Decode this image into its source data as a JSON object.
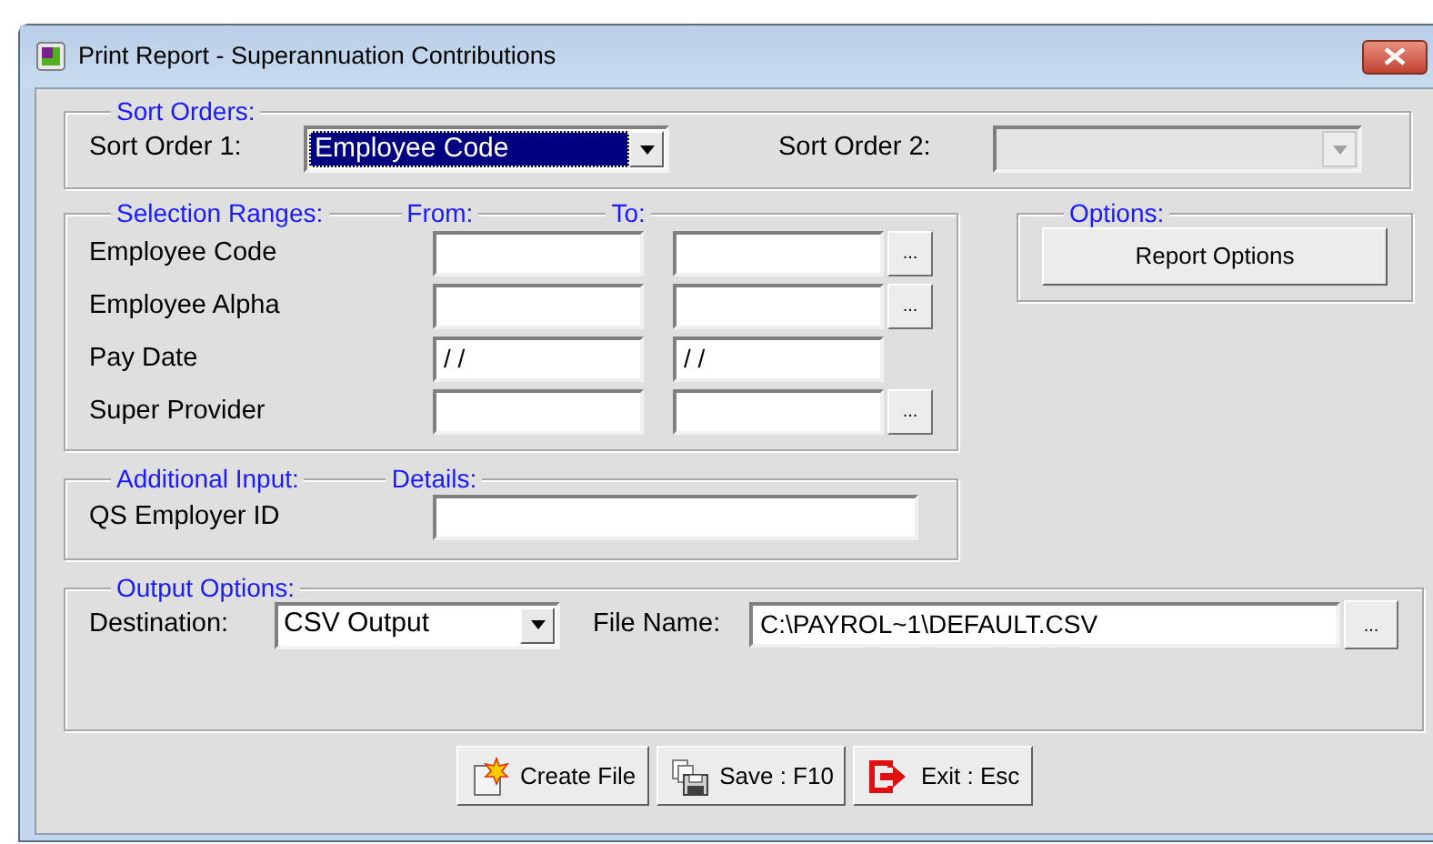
{
  "window": {
    "title": "Print Report - Superannuation Contributions"
  },
  "sort_orders": {
    "legend": "Sort Orders:",
    "fields": [
      {
        "label": "Sort Order 1:",
        "value": "Employee Code",
        "focused": true,
        "disabled": false
      },
      {
        "label": "Sort Order 2:",
        "focused": false,
        "disabled": true
      }
    ]
  },
  "selection_ranges": {
    "legend": "Selection Ranges:",
    "from_label": "From:",
    "to_label": "To:",
    "rows": [
      {
        "label": "Employee Code",
        "lookup": "..."
      },
      {
        "label": "Employee Alpha",
        "lookup": "..."
      },
      {
        "label": "Pay Date",
        "from": "/ /",
        "to": "/ /"
      },
      {
        "label": "Super Provider",
        "lookup": "..."
      }
    ]
  },
  "options": {
    "legend": "Options:",
    "button": "Report Options"
  },
  "additional_input": {
    "legend": "Additional Input:",
    "details_label": "Details:",
    "rows": [
      {
        "label": "QS Employer ID"
      }
    ]
  },
  "output_options": {
    "legend": "Output Options:",
    "destination_label": "Destination:",
    "destination": "CSV Output",
    "file_name_label": "File Name:",
    "file_name": "C:\\PAYROL~1\\DEFAULT.CSV",
    "browse": "..."
  },
  "buttons": [
    {
      "label": "Create File",
      "kind": "create"
    },
    {
      "label": "Save : F10",
      "kind": "save"
    },
    {
      "label": "Exit : Esc",
      "kind": "exit"
    }
  ]
}
